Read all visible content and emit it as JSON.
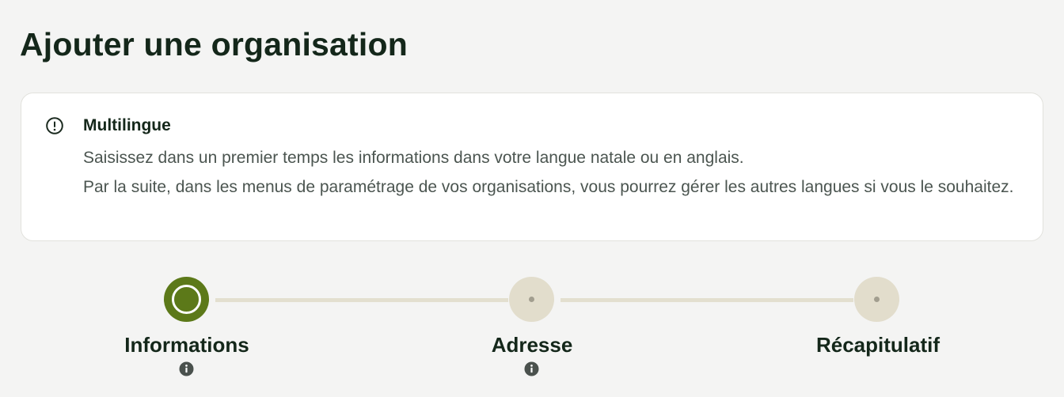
{
  "page": {
    "title": "Ajouter une organisation"
  },
  "notice": {
    "icon": "exclamation-circle-icon",
    "title": "Multilingue",
    "lines": [
      "Saisissez dans un premier temps les informations dans votre langue natale ou en anglais.",
      "Par la suite, dans les menus de paramétrage de vos organisations, vous pourrez gérer les autres langues si vous le souhaitez."
    ]
  },
  "stepper": {
    "steps": [
      {
        "label": "Informations",
        "state": "active",
        "info_icon": "info-circle-icon"
      },
      {
        "label": "Adresse",
        "state": "pending",
        "info_icon": "info-circle-icon"
      },
      {
        "label": "Récapitulatif",
        "state": "pending"
      }
    ]
  },
  "colors": {
    "active_step": "#5c7919",
    "pending_step": "#e2ddcc",
    "connector": "#e3dfcf",
    "title_text": "#14271a",
    "body_text": "#4b5550",
    "background": "#f4f4f3"
  }
}
